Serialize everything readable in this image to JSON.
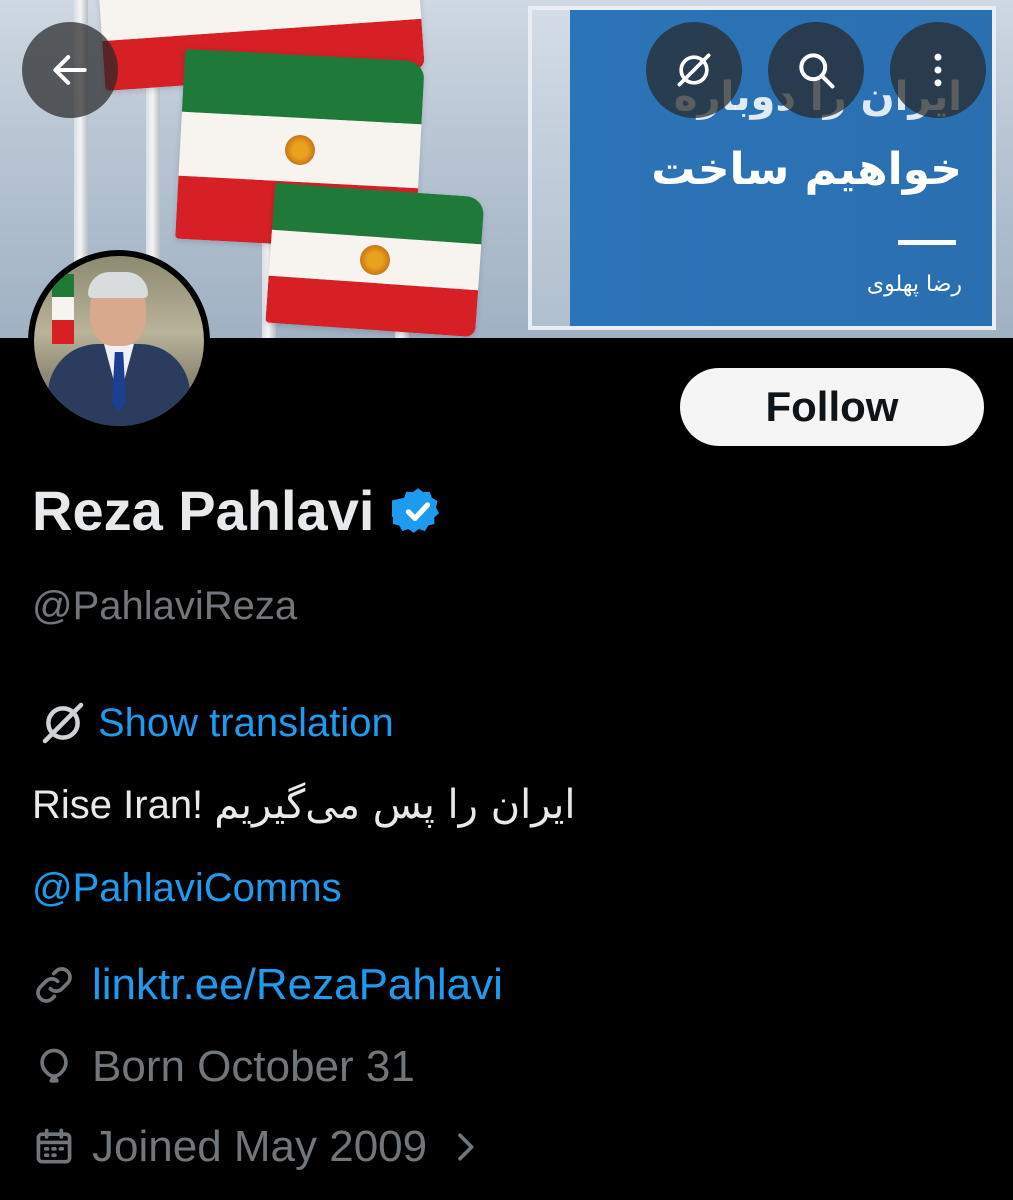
{
  "header": {
    "back_icon": "arrow-left-icon",
    "translate_icon": "grok-translate-icon",
    "search_icon": "search-icon",
    "more_icon": "more-vertical-icon"
  },
  "banner": {
    "text_line1": "ایران را دوباره",
    "text_line2": "خواهیم ساخت",
    "signature": "رضا پهلوی"
  },
  "profile": {
    "follow_label": "Follow",
    "name": "Reza Pahlavi",
    "verified_icon": "verified-badge-icon",
    "handle": "@PahlaviReza",
    "show_translation": "Show translation",
    "bio_en": "Rise Iran!",
    "bio_fa": "ایران را پس می‌گیریم",
    "mention": "@PahlaviComms",
    "link": "linktr.ee/RezaPahlavi",
    "born": "Born October 31",
    "joined": "Joined May 2009"
  },
  "colors": {
    "background": "#000000",
    "text": "#e7e9ea",
    "muted": "#71767b",
    "accent": "#1d9bf0",
    "follow_bg": "#f5f5f5"
  }
}
